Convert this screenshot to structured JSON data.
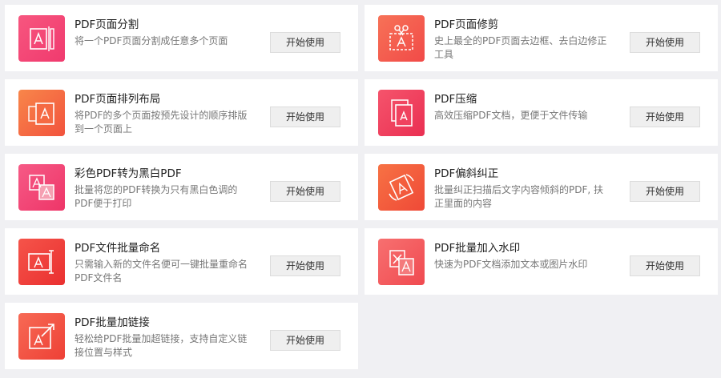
{
  "tools": [
    {
      "title": "PDF页面分割",
      "desc": "将一个PDF页面分割成任意多个页面",
      "button": "开始使用",
      "icon": "page-split-icon",
      "color": "#f5447a"
    },
    {
      "title": "PDF页面修剪",
      "desc": "史上最全的PDF页面去边框、去白边修正工具",
      "button": "开始使用",
      "icon": "page-trim-icon",
      "color": "#f55a4e"
    },
    {
      "title": "PDF页面排列布局",
      "desc": "将PDF的多个页面按预先设计的顺序排版到一个页面上",
      "button": "开始使用",
      "icon": "page-layout-icon",
      "color": "#f5683e"
    },
    {
      "title": "PDF压缩",
      "desc": "高效压缩PDF文档，更便于文件传输",
      "button": "开始使用",
      "icon": "compress-icon",
      "color": "#f04462"
    },
    {
      "title": "彩色PDF转为黑白PDF",
      "desc": "批量将您的PDF转换为只有黑白色调的PDF便于打印",
      "button": "开始使用",
      "icon": "color-to-bw-icon",
      "color": "#f24a78"
    },
    {
      "title": "PDF偏斜纠正",
      "desc": "批量纠正扫描后文字内容倾斜的PDF, 扶正里面的内容",
      "button": "开始使用",
      "icon": "skew-correct-icon",
      "color": "#f5573f"
    },
    {
      "title": "PDF文件批量命名",
      "desc": "只需输入新的文件名便可一键批量重命名PDF文件名",
      "button": "开始使用",
      "icon": "batch-rename-icon",
      "color": "#f2453c"
    },
    {
      "title": "PDF批量加入水印",
      "desc": "快速为PDF文档添加文本或图片水印",
      "button": "开始使用",
      "icon": "watermark-icon",
      "color": "#f5535a"
    },
    {
      "title": "PDF批量加链接",
      "desc": "轻松给PDF批量加超链接，支持自定义链接位置与样式",
      "button": "开始使用",
      "icon": "add-link-icon",
      "color": "#f4513f"
    }
  ]
}
